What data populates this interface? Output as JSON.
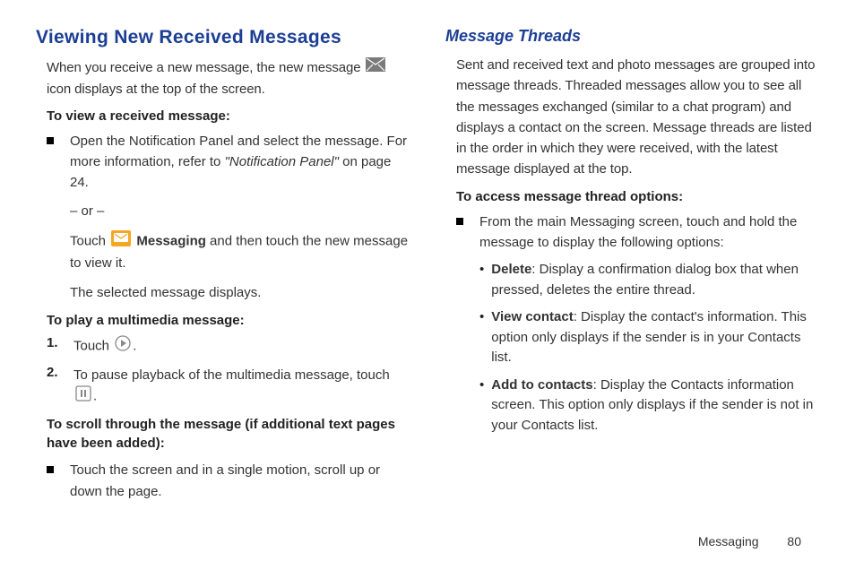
{
  "left": {
    "heading": "Viewing New Received Messages",
    "intro_a": "When you receive a new message, the new message",
    "intro_b": "icon displays at the top of the screen.",
    "sec1_title": "To view a received message:",
    "sec1_bullet_a": "Open the Notification Panel and select the message. For more information, refer to ",
    "sec1_bullet_ref": "\"Notification Panel\"",
    "sec1_bullet_b": " on page 24.",
    "sec1_or": "– or –",
    "sec1_touch_a": "Touch ",
    "sec1_touch_b": " Messaging",
    "sec1_touch_c": " and then touch the new message to view it.",
    "sec1_result": "The selected message displays.",
    "sec2_title": "To play a multimedia message:",
    "sec2_step1_a": "Touch ",
    "sec2_step1_b": ".",
    "sec2_step2_a": "To pause playback of the multimedia message, touch ",
    "sec2_step2_b": ".",
    "sec3_title": "To scroll through the message (if additional text pages have been added):",
    "sec3_bullet": "Touch the screen and in a single motion, scroll up or down the page.",
    "num1": "1.",
    "num2": "2."
  },
  "right": {
    "heading": "Message Threads",
    "intro": "Sent and received text and photo messages are grouped into message threads. Threaded messages allow you to see all the messages exchanged (similar to a chat program) and displays a contact on the screen. Message threads are listed in the order in which they were received, with the latest message displayed at the top.",
    "sec1_title": "To access message thread options:",
    "sec1_bullet": "From the main Messaging screen, touch and hold the message to display the following options:",
    "opt1_b": "Delete",
    "opt1_t": ": Display a confirmation dialog box that when pressed, deletes the entire thread.",
    "opt2_b": "View contact",
    "opt2_t": ": Display the contact's information. This option only displays if the sender is in your Contacts list.",
    "opt3_b": "Add to contacts",
    "opt3_t": ": Display the Contacts information screen. This option only displays if the sender is not in your Contacts list."
  },
  "footer": {
    "section": "Messaging",
    "page": "80"
  }
}
